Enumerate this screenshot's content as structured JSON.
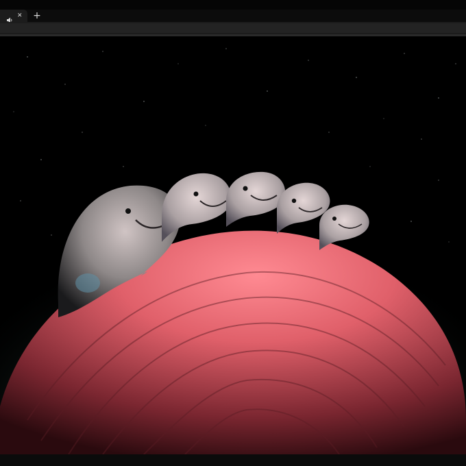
{
  "browser": {
    "tab": {
      "audio_icon": "speaker-icon",
      "close_icon": "close-icon",
      "close_glyph": "✕"
    },
    "new_tab": {
      "icon": "plus-icon",
      "glyph": "+"
    }
  },
  "scene": {
    "description_icon": "3d-render-image",
    "creature_count": 5,
    "colors": {
      "background": "#000000",
      "planet": "#e0606a",
      "creatures": "#b8b0b0",
      "mist": "#6f9a8c"
    }
  }
}
